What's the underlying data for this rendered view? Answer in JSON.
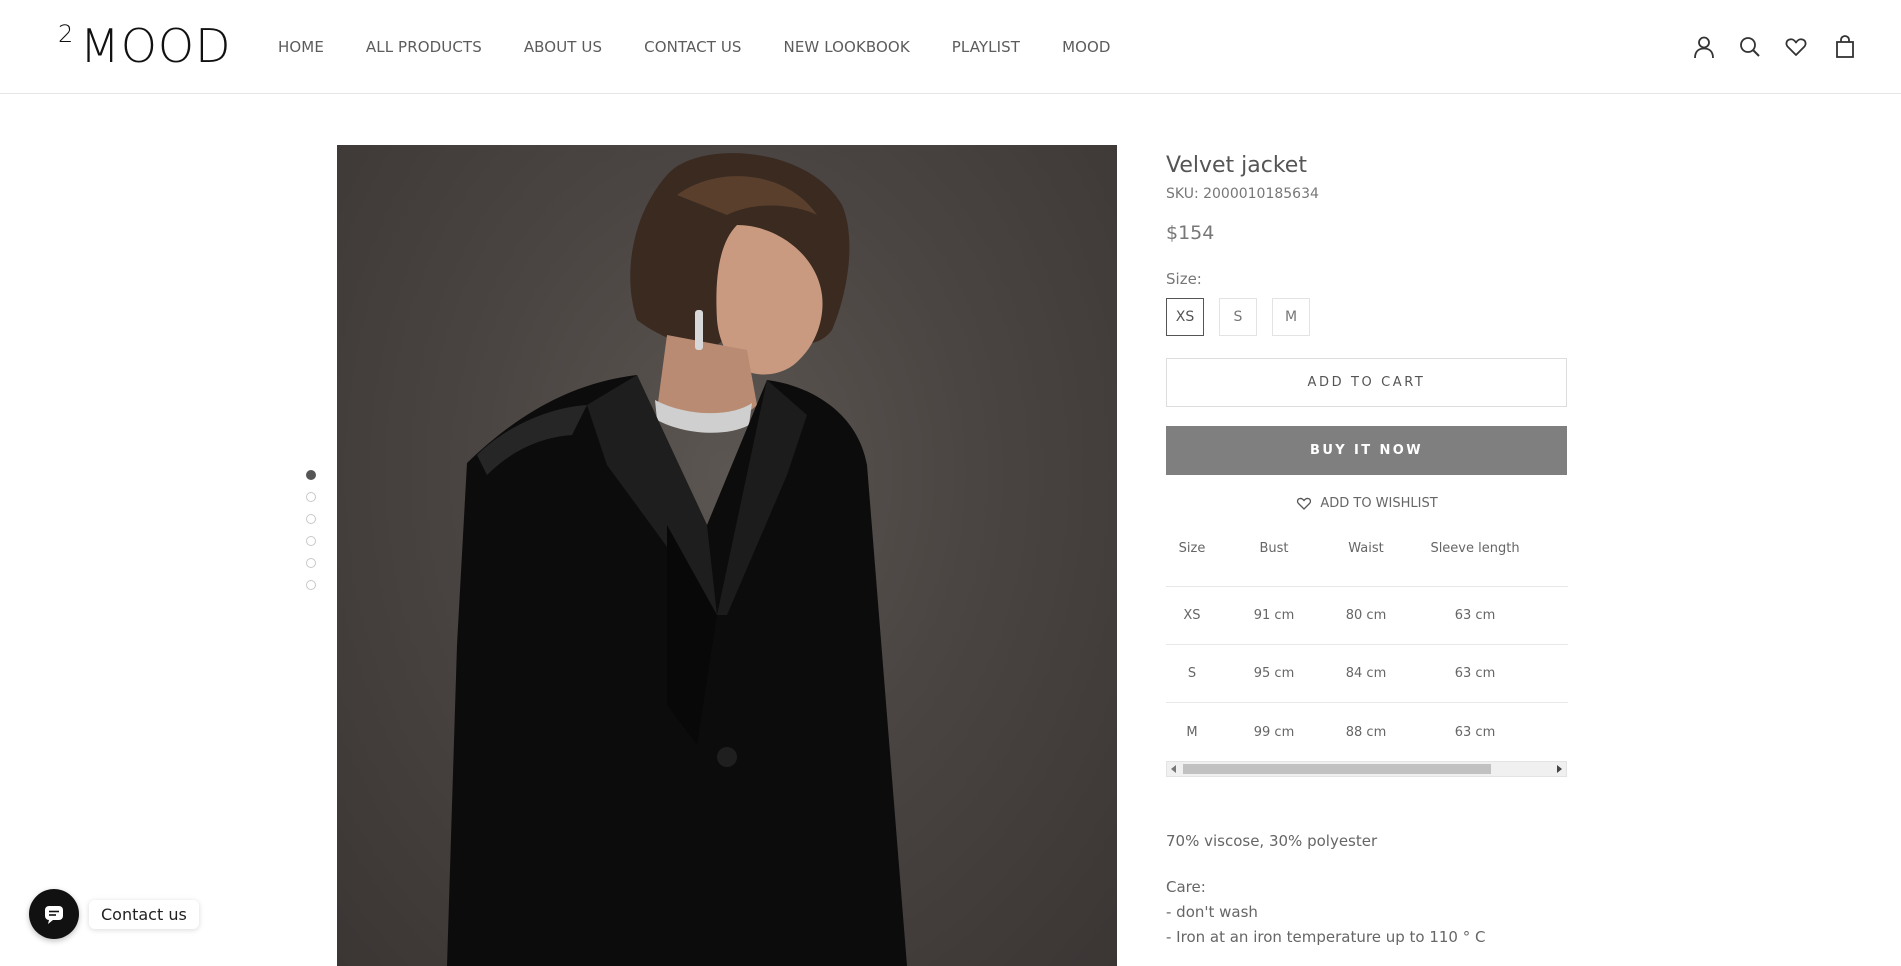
{
  "header": {
    "logo_sup": "2",
    "logo_main": "MOOD",
    "nav": [
      "HOME",
      "ALL PRODUCTS",
      "ABOUT US",
      "CONTACT US",
      "NEW LOOKBOOK",
      "PLAYLIST",
      "MOOD"
    ],
    "icons": [
      "account-icon",
      "search-icon",
      "wishlist-heart-icon",
      "cart-bag-icon"
    ]
  },
  "gallery": {
    "dots_total": 6,
    "active_index": 0
  },
  "product": {
    "title": "Velvet jacket",
    "sku": "SKU: 2000010185634",
    "price": "$154",
    "size_label": "Size:",
    "sizes": [
      "XS",
      "S",
      "M"
    ],
    "selected_size": "XS",
    "add_to_cart": "ADD TO CART",
    "buy_now": "BUY IT NOW",
    "wishlist": "ADD TO WISHLIST"
  },
  "size_table": {
    "headers": [
      "Size",
      "Bust",
      "Waist",
      "Sleeve length"
    ],
    "rows": [
      [
        "XS",
        "91 cm",
        "80 cm",
        "63 cm"
      ],
      [
        "S",
        "95 cm",
        "84 cm",
        "63 cm"
      ],
      [
        "M",
        "99 cm",
        "88 cm",
        "63 cm"
      ]
    ]
  },
  "details": {
    "composition": "70% viscose, 30% polyester",
    "care_title": "Care:",
    "care_lines": [
      "- don't wash",
      "- Iron at an iron temperature up to 110 ° C"
    ]
  },
  "chat": {
    "label": "Contact us"
  },
  "colors": {
    "buy_button": "#7f7f7f",
    "text": "#5c5c5c",
    "photo_bg": "#4a4442"
  }
}
